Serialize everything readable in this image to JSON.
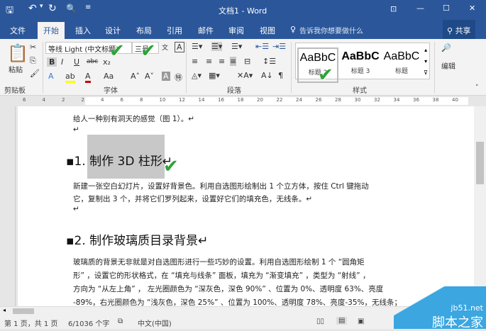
{
  "title": "文档1 - Word",
  "qat": {
    "save": "save-icon",
    "undo": "undo-icon",
    "redo": "redo-icon",
    "preview": "print-preview-icon",
    "more": "customize-icon"
  },
  "window_controls": {
    "ribbon_opts": "⊡",
    "min": "—",
    "max": "☐",
    "close": "✕"
  },
  "tabs": [
    "文件",
    "开始",
    "插入",
    "设计",
    "布局",
    "引用",
    "邮件",
    "审阅",
    "视图"
  ],
  "active_tab": "开始",
  "tell_me": "告诉我你想要做什么",
  "share": "共享",
  "clipboard": {
    "paste": "粘贴",
    "label": "剪贴板"
  },
  "font": {
    "name": "等线 Light (中文标题)",
    "size": "三号",
    "label": "字体",
    "bold": "B",
    "italic": "I",
    "underline": "U",
    "strike": "abc",
    "sub": "x₂",
    "grow": "A˄",
    "shrink": "A˅",
    "case": "Aa"
  },
  "paragraph": {
    "label": "段落"
  },
  "styles": {
    "items": [
      "AaBbC",
      "AaBbC",
      "AaBbC"
    ],
    "names": [
      "标题 2",
      "标题 3",
      "标题"
    ],
    "label": "样式"
  },
  "editing": {
    "label": "编辑"
  },
  "ruler_nums": [
    "6",
    "4",
    "2",
    "2",
    "4",
    "6",
    "8",
    "10",
    "12",
    "14",
    "16",
    "18",
    "20",
    "22",
    "24",
    "26",
    "28",
    "30",
    "32",
    "34",
    "36",
    "38",
    "40"
  ],
  "document": {
    "lines_top": [
      "给人一种别有洞天的感觉（图 1）。↵",
      "↵"
    ],
    "heading1": "1. 制作 3D 柱形",
    "para1": [
      "新建一张空白幻灯片，设置好背景色。利用自选图形绘制出 1 个立方体，按住 Ctrl 键拖动",
      "它，复制出 3 个，并将它们罗列起来，设置好它们的填充色，无线条。↵",
      "↵"
    ],
    "heading2": "2. 制作玻璃质目录背景",
    "para2": [
      "玻璃质的背景无非就是对自选图形进行一些巧妙的设置。利用自选图形绘制 1 个 “圆角矩",
      "形” ，设置它的形状格式，在 “填充与线条” 面板，填充为 “渐变填充” ，类型为 “射线” ，",
      "方向为 “从左上角” ， 左光圈颜色为 “深灰色，深色 90%” 、位置为 0%、透明度 63%、亮度",
      "-89%，右光圈颜色为 “浅灰色，深色 25%” 、位置为 100%、透明度 78%、亮度-35%，无线条；"
    ]
  },
  "status": {
    "page": "第 1 页，共 1 页",
    "words": "6/1036 个字",
    "lang": "中文(中国)"
  },
  "watermark": {
    "url": "jb51.net",
    "name": "脚本之家"
  },
  "colors": {
    "accent": "#2b579a",
    "check": "#2da338"
  }
}
